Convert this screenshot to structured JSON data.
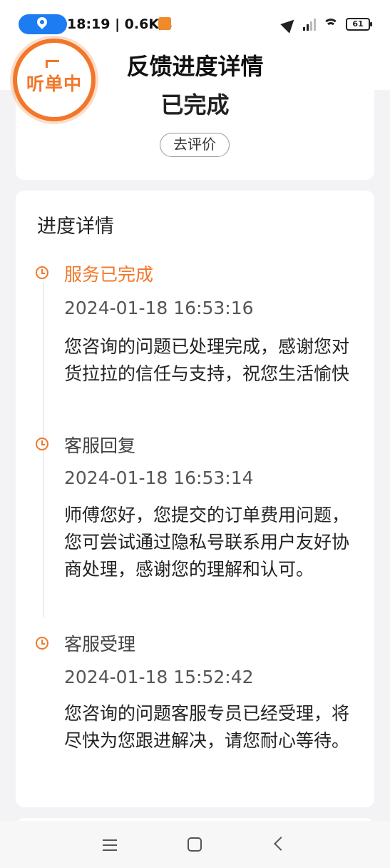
{
  "status_bar": {
    "time": "18:19",
    "network_speed": "0.6K/s",
    "battery": "61"
  },
  "badge": {
    "label": "听单中"
  },
  "header": {
    "title": "反馈进度详情"
  },
  "status": {
    "text": "已完成",
    "rate_button": "去评价"
  },
  "progress": {
    "title": "进度详情",
    "entries": [
      {
        "title": "服务已完成",
        "time": "2024-01-18 16:53:16",
        "desc": "您咨询的问题已处理完成，感谢您对货拉拉的信任与支持，祝您生活愉快"
      },
      {
        "title": "客服回复",
        "time": "2024-01-18 16:53:14",
        "desc": "师傅您好，您提交的订单费用问题，您可尝试通过隐私号联系用户友好协商处理，感谢您的理解和认可。"
      },
      {
        "title": "客服受理",
        "time": "2024-01-18 15:52:42",
        "desc": "您咨询的问题客服专员已经受理，将尽快为您跟进解决，请您耐心等待。"
      }
    ]
  },
  "colors": {
    "accent": "#f2772a",
    "status_pill": "#1e7cf2"
  }
}
